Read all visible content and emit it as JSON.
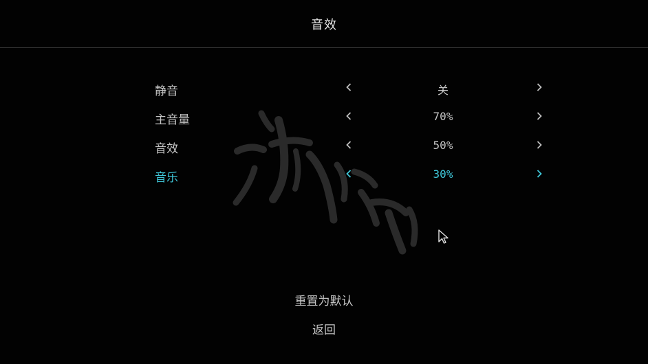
{
  "header": {
    "title": "音效"
  },
  "settings": [
    {
      "label": "静音",
      "value": "关",
      "active": false
    },
    {
      "label": "主音量",
      "value": "70%",
      "active": false
    },
    {
      "label": "音效",
      "value": "50%",
      "active": false
    },
    {
      "label": "音乐",
      "value": "30%",
      "active": true
    }
  ],
  "buttons": {
    "reset_label": "重置为默认",
    "back_label": "返回"
  },
  "colors": {
    "background": "#020202",
    "text": "#c4c4c4",
    "highlight": "#3fc6d8",
    "divider": "#3a3a3a"
  },
  "icons": {
    "decrease": "chevron-left-icon",
    "increase": "chevron-right-icon",
    "cursor": "mouse-pointer-icon"
  }
}
